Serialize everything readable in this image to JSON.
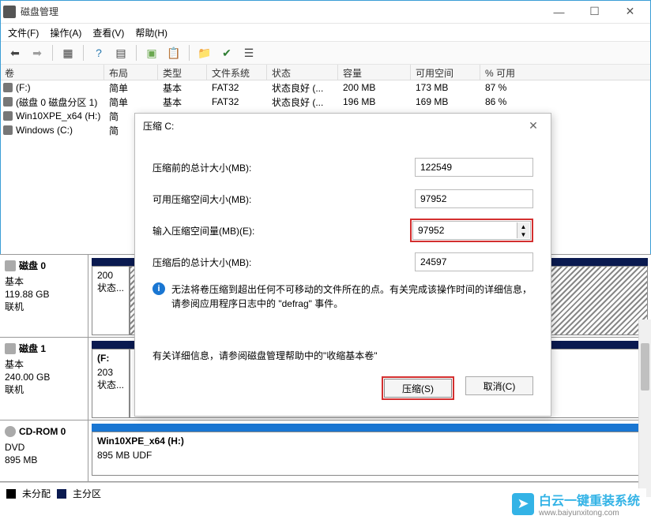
{
  "window": {
    "title": "磁盘管理",
    "minimize": "—",
    "maximize": "☐",
    "close": "✕"
  },
  "menu": {
    "file": "文件(F)",
    "operation": "操作(A)",
    "view": "查看(V)",
    "help": "帮助(H)"
  },
  "columns": {
    "volume": "卷",
    "layout": "布局",
    "type": "类型",
    "filesystem": "文件系统",
    "status": "状态",
    "capacity": "容量",
    "free": "可用空间",
    "pct": "% 可用"
  },
  "rows": [
    {
      "vol": "(F:)",
      "layout": "简单",
      "type": "基本",
      "fs": "FAT32",
      "status": "状态良好 (...",
      "cap": "200 MB",
      "free": "173 MB",
      "pct": "87 %"
    },
    {
      "vol": "(磁盘 0 磁盘分区 1)",
      "layout": "简单",
      "type": "基本",
      "fs": "FAT32",
      "status": "状态良好 (...",
      "cap": "196 MB",
      "free": "169 MB",
      "pct": "86 %"
    },
    {
      "vol": "Win10XPE_x64 (H:)",
      "layout": "简",
      "type": "",
      "fs": "",
      "status": "",
      "cap": "",
      "free": "",
      "pct": ""
    },
    {
      "vol": "Windows (C:)",
      "layout": "简",
      "type": "",
      "fs": "",
      "status": "",
      "cap": "",
      "free": "",
      "pct": ""
    }
  ],
  "disks": [
    {
      "name": "磁盘 0",
      "type": "基本",
      "size": "119.88 GB",
      "status": "联机",
      "vol": {
        "size": "200",
        "state": "状态..."
      }
    },
    {
      "name": "磁盘 1",
      "type": "基本",
      "size": "240.00 GB",
      "status": "联机",
      "vol": {
        "name": "(F:",
        "size": "203",
        "state": "状态..."
      }
    },
    {
      "name": "CD-ROM 0",
      "type": "DVD",
      "size": "895 MB",
      "status": "",
      "vol": {
        "name": "Win10XPE_x64  (H:)",
        "size": "895 MB UDF"
      }
    }
  ],
  "legend": {
    "unalloc": "未分配",
    "primary": "主分区"
  },
  "watermark": {
    "main": "白云一键重装系统",
    "sub": "www.baiyunxitong.com"
  },
  "dialog": {
    "title": "压缩 C:",
    "close": "✕",
    "label_total_before": "压缩前的总计大小(MB):",
    "val_total_before": "122549",
    "label_shrink_avail": "可用压缩空间大小(MB):",
    "val_shrink_avail": "97952",
    "label_shrink_input": "输入压缩空间量(MB)(E):",
    "val_shrink_input": "97952",
    "label_total_after": "压缩后的总计大小(MB):",
    "val_total_after": "24597",
    "info_text": "无法将卷压缩到超出任何不可移动的文件所在的点。有关完成该操作时间的详细信息，请参阅应用程序日志中的 \"defrag\" 事件。",
    "help_text": "有关详细信息，请参阅磁盘管理帮助中的\"收缩基本卷\"",
    "btn_shrink": "压缩(S)",
    "btn_cancel": "取消(C)"
  }
}
